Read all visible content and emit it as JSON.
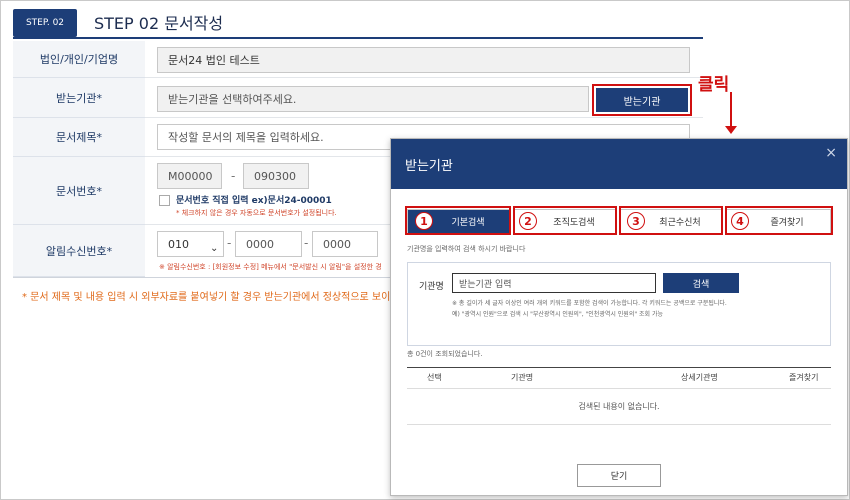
{
  "step": {
    "badge": "STEP. 02",
    "title": "STEP 02 문서작성"
  },
  "form": {
    "org_label": "법인/개인/기업명",
    "org_value": "문서24 법인 테스트",
    "recipient_label": "받는기관*",
    "recipient_placeholder": "받는기관을 선택하여주세요.",
    "recipient_button": "받는기관",
    "subject_label": "문서제목*",
    "subject_placeholder": "작성할 문서의 제목을 입력하세요.",
    "docnum_label": "문서번호*",
    "docnum_prefix": "M00000",
    "docnum_suffix": "090300",
    "docnum_dash": "-",
    "docnum_checkbox_label": "문서번호 직접 입력 ex)문서24-00001",
    "docnum_note": "* 체크하지 않은 경우 자동으로 문서번호가 설정됩니다.",
    "phone_label": "알림수신번호*",
    "phone_prefix": "010",
    "phone_mid": "0000",
    "phone_last": "0000",
    "phone_note": "※ 알림수신번호 : [회원정보 수정] 메뉴에서 \"문서발신 시 알림\"을 설정한 경",
    "bottom_note": "* 문서 제목 및 내용 입력 시 외부자료를 붙여넣기 할 경우 받는기관에서 정상적으로 보이"
  },
  "annotation": {
    "click_label": "클릭"
  },
  "modal": {
    "title": "받는기관",
    "close": "×",
    "tabs": [
      {
        "num": "1",
        "label": "기본검색"
      },
      {
        "num": "2",
        "label": "조직도검색"
      },
      {
        "num": "3",
        "label": "최근수신처"
      },
      {
        "num": "4",
        "label": "즐겨찾기"
      }
    ],
    "instruction": "기관명을 입력하여 검색 하시기 바랍니다",
    "search_label": "기관명",
    "search_placeholder": "받는기관 입력",
    "search_button": "검색",
    "hint1": "※ 총 길이가 세 글자 이상인 여러 개의 키워드를 포함한 검색이 가능합니다. 각 키워드는 공백으로 구분됩니다.",
    "hint2": "예) \"광역시 인원\"으로 검색 시 \"부산광역시 인원의\", \"인천광역시 인원의\" 조회 가능",
    "result_count": "총 0건이 조회되었습니다.",
    "columns": [
      "선택",
      "기관명",
      "상세기관명",
      "즐겨찾기"
    ],
    "empty_message": "검색된 내용이 없습니다.",
    "close_button": "닫기"
  },
  "colors": {
    "primary": "#1d3e78",
    "annotation_red": "#d01010",
    "note_orange": "#e06a1a"
  }
}
